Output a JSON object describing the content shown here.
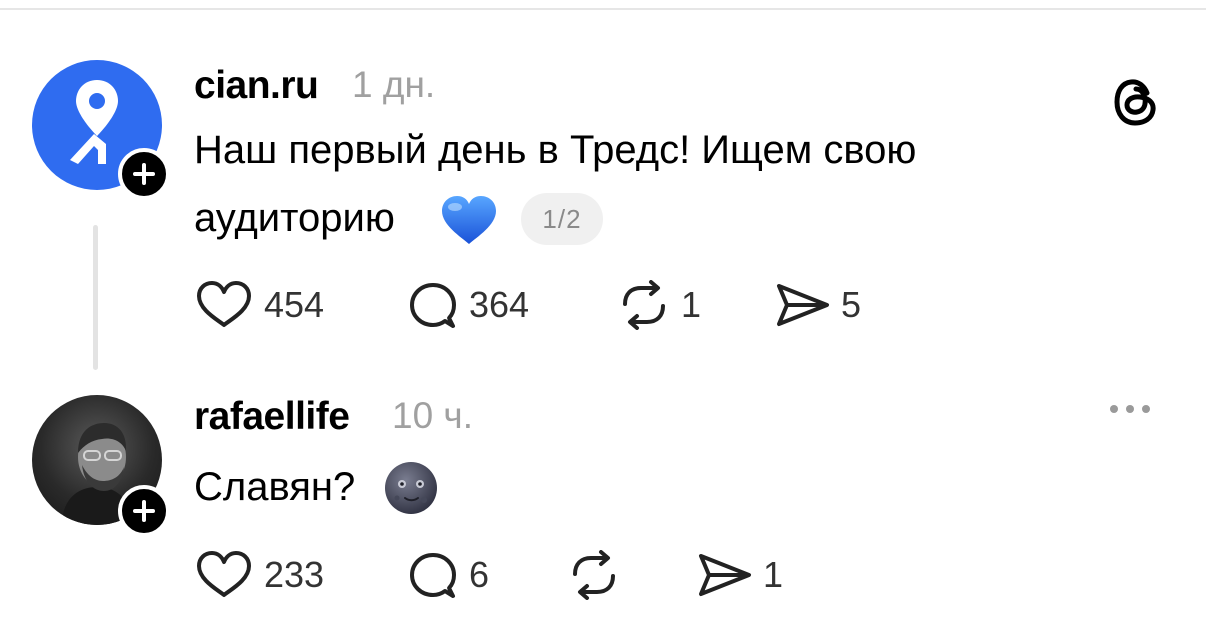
{
  "posts": [
    {
      "username": "cian.ru",
      "time": "1 дн.",
      "text_line1": "Наш первый день в Тредс! Ищем свою",
      "text_line2": "аудиторию",
      "emoji": "blue-heart",
      "page_indicator": "1/2",
      "likes": "454",
      "replies": "364",
      "reposts": "1",
      "shares": "5",
      "brand_color": "#2f6cf0"
    },
    {
      "username": "rafaellife",
      "time": "10 ч.",
      "text": "Славян?",
      "emoji": "new-moon-face",
      "likes": "233",
      "replies": "6",
      "reposts": "",
      "shares": "1"
    }
  ],
  "icons": {
    "app_logo": "threads-icon",
    "more": "more-icon",
    "like": "heart-icon",
    "reply": "comment-icon",
    "repost": "repost-icon",
    "share": "send-icon"
  }
}
